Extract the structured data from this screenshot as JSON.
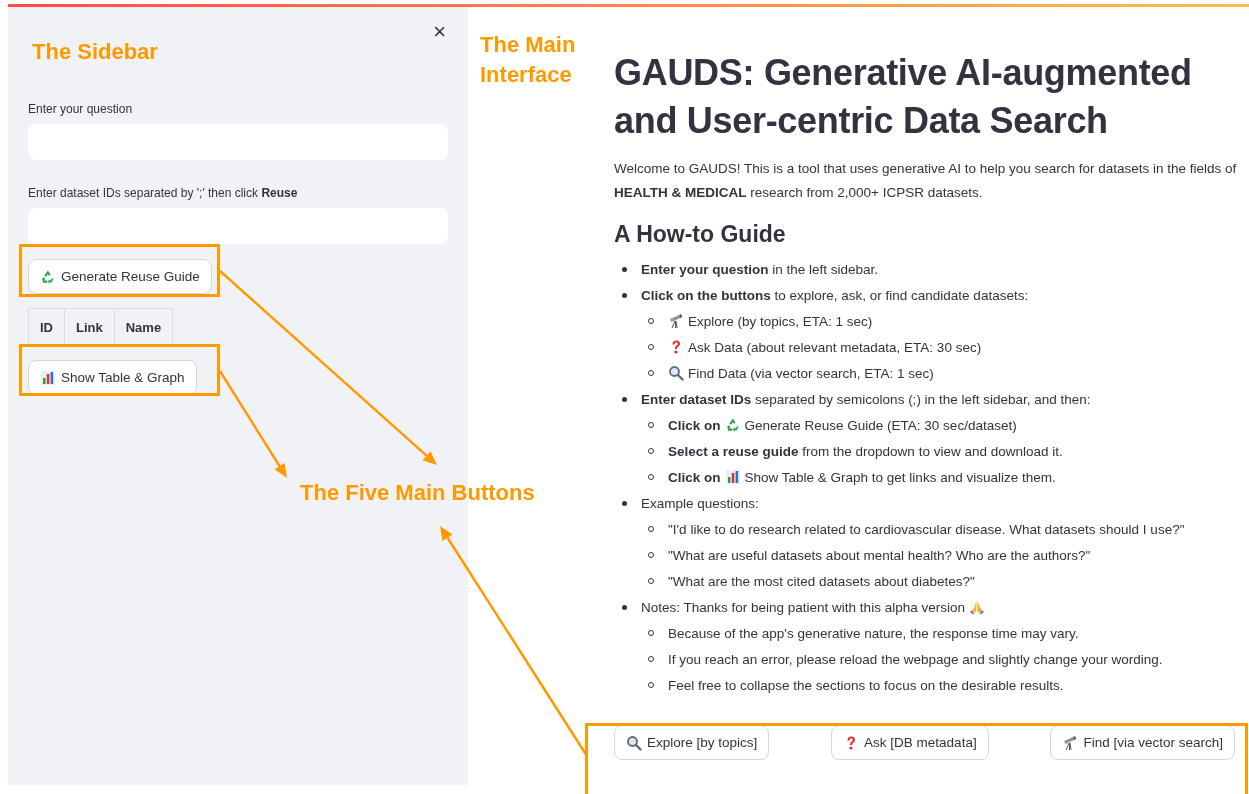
{
  "sidebar": {
    "close": "×",
    "fields": [
      {
        "label": "Enter your question"
      },
      {
        "label": "Enter dataset IDs separated by ';' then click **Reuse**"
      }
    ],
    "reuse_button": {
      "label": "Generate Reuse Guide",
      "kind": "recycle"
    },
    "table": {
      "columns": [
        "ID",
        "Link",
        "Name"
      ]
    },
    "graph_button": {
      "label": "Show Table & Graph",
      "kind": "chart"
    }
  },
  "main": {
    "title": "GAUDS: Generative AI-augmented and User-centric Data Search",
    "intro": "Welcome to GAUDS! This is a tool that uses generative AI to help you search for datasets in the fields of **HEALTH & MEDICAL** research from 2,000+ ICPSR datasets.",
    "guide_title": "A How-to Guide",
    "items": [
      {
        "kind": "text",
        "text": "**Enter your question** in the left sidebar."
      },
      {
        "kind": "text",
        "text": "**Click on the buttons** to explore, ask, or find candidate datasets:",
        "children": [
          {
            "kind": "telescope",
            "text": "Explore (by topics, ETA: 1 sec)"
          },
          {
            "kind": "question",
            "text": "Ask Data (about relevant metadata, ETA: 30 sec)"
          },
          {
            "kind": "search",
            "text": "Find Data (via vector search, ETA: 1 sec)"
          }
        ]
      },
      {
        "kind": "text",
        "text": "**Enter dataset IDs** separated by semicolons (;) in the left sidebar, and then:",
        "children": [
          {
            "kind": "recycle",
            "lead": "Click on",
            "text": "Generate Reuse Guide (ETA: 30 sec/dataset)"
          },
          {
            "kind": "text",
            "text": "**Select a reuse guide** from the dropdown to view and download it."
          },
          {
            "kind": "chart",
            "lead": "Click on",
            "text": "Show Table & Graph to get links and visualize them."
          }
        ]
      },
      {
        "kind": "text",
        "text": "Example questions:",
        "children": [
          {
            "kind": "text",
            "text": "\"I'd like to do research related to cardiovascular disease. What datasets should I use?\""
          },
          {
            "kind": "text",
            "text": "\"What are useful datasets about mental health? Who are the authors?\""
          },
          {
            "kind": "text",
            "text": "\"What are the most cited datasets about diabetes?\""
          }
        ]
      },
      {
        "kind": "pray",
        "text": "Notes: Thanks for being patient with this alpha version",
        "children": [
          {
            "kind": "text",
            "text": "Because of the app's generative nature, the response time may vary."
          },
          {
            "kind": "text",
            "text": "If you reach an error, please reload the webpage and slightly change your wording."
          },
          {
            "kind": "text",
            "text": "Feel free to collapse the sections to focus on the desirable results."
          }
        ]
      }
    ],
    "buttons": [
      {
        "kind": "search",
        "label": "Explore [by topics]"
      },
      {
        "kind": "question",
        "label": "Ask [DB metadata]"
      },
      {
        "kind": "telescope",
        "label": "Find [via vector search]"
      }
    ]
  },
  "annotations": {
    "sidebar_label": "The Sidebar",
    "main_label": "The Main Interface",
    "buttons_label": "The Five Main Buttons"
  }
}
